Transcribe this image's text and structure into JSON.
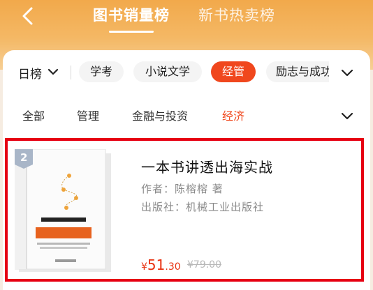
{
  "header": {
    "tabs": [
      {
        "label": "图书销量榜",
        "active": true
      },
      {
        "label": "新书热卖榜",
        "active": false
      }
    ]
  },
  "filters": {
    "period": "日榜",
    "categories": [
      "学考",
      "小说文学",
      "经管",
      "励志与成功"
    ],
    "selected_category": "经管",
    "subcategories": [
      "全部",
      "管理",
      "金融与投资",
      "经济"
    ],
    "selected_subcategory": "经济"
  },
  "book": {
    "rank": "2",
    "title": "一本书讲透出海实战",
    "author": "作者：陈榕榕 著",
    "publisher": "出版社：机械工业出版社",
    "price_symbol": "¥",
    "price_int": "51",
    "price_dec": ".30",
    "original_price": "¥79.00"
  },
  "colors": {
    "accent": "#f0471d",
    "price": "#e8300f",
    "highlight_border": "#e60012",
    "header_orange": "#f2a94b"
  }
}
